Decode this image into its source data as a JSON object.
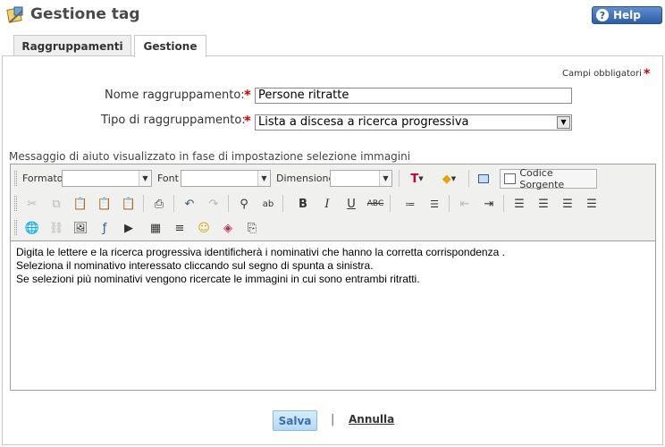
{
  "header": {
    "title": "Gestione tag",
    "help_label": "Help"
  },
  "tabs": [
    {
      "label": "Raggruppamenti",
      "active": false
    },
    {
      "label": "Gestione",
      "active": true
    }
  ],
  "form": {
    "required_note": "Campi obbligatori",
    "name_label": "Nome raggruppamento:",
    "name_value": "Persone ritratte",
    "type_label": "Tipo di raggruppamento:",
    "type_value": "Lista a discesa a ricerca progressiva",
    "help_message_label": "Messaggio di aiuto visualizzato in fase di impostazione selezione immagini"
  },
  "editor": {
    "toolbar": {
      "format_label": "Formato",
      "font_label": "Font",
      "size_label": "Dimensione",
      "source_label": "Codice Sorgente"
    },
    "content_lines": [
      "Digita le lettere e la ricerca progressiva identificherà i nominativi che hanno la corretta corrispondenza .",
      "Seleziona il nominativo interessato cliccando sul segno di spunta a sinistra.",
      "Se selezioni più nominativi vengono ricercate le immagini in cui sono entrambi ritratti."
    ]
  },
  "footer": {
    "save_label": "Salva",
    "separator": "|",
    "cancel_label": "Annulla"
  },
  "colors": {
    "required_star": "#cc0000",
    "help_button": "#2c5ea8",
    "save_button": "#b3daf5"
  }
}
